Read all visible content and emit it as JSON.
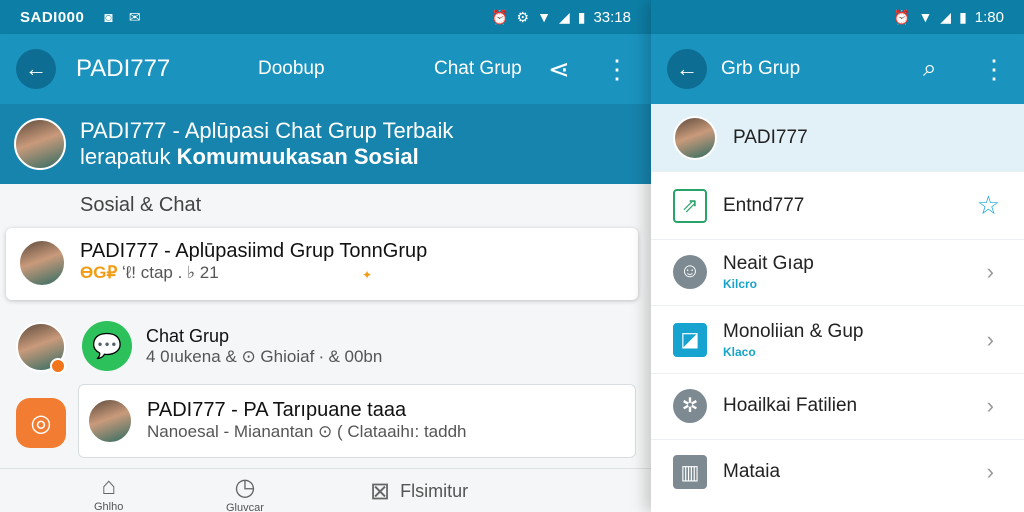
{
  "left": {
    "status": {
      "carrier": "SADI000",
      "time": "33:18"
    },
    "appbar": {
      "title": "PADI777",
      "tab_center": "Doobup",
      "tab_right": "Chat Grup"
    },
    "banner": {
      "line1": "PADI777 - Aplūpasi Chat Grup Terbaik",
      "line2_prefix": "lerapatuk ",
      "line2_bold": "Komumuukasan Sosial"
    },
    "section_label": "Sosial & Chat",
    "featured": {
      "title": "PADI777 - Aplūpasiimd Grup  TonnGrup",
      "badge": "ӨԌ₽",
      "sub": "ʻℓ! ctap . ♭  21"
    },
    "chat_item": {
      "title": "Chat Grup",
      "sub": "4 0ıukena & ⊙  Ghioiaf ∙ & 00bn"
    },
    "card2": {
      "title": "PADI777 - PA Tarıpuane taaa",
      "sub": "Nanoesal - Mianantan ⊙  ( Clataaihı: taddh"
    },
    "bottom_nav": [
      {
        "label": "Ghlho"
      },
      {
        "label": "Gluvcar"
      },
      {
        "label": "Flsimitur"
      }
    ]
  },
  "right": {
    "status": {
      "time": "1:80"
    },
    "appbar": {
      "title": "Grb Grup"
    },
    "rows": [
      {
        "title": "PADI777",
        "sub": ""
      },
      {
        "title": "Entnd777",
        "sub": ""
      },
      {
        "title": "Neait Gıap",
        "sub": "Kilcro"
      },
      {
        "title": "Monoliian & Gup",
        "sub": "Klaco"
      },
      {
        "title": "Hoailkai Fatilien",
        "sub": ""
      },
      {
        "title": "Mataia",
        "sub": ""
      }
    ]
  }
}
